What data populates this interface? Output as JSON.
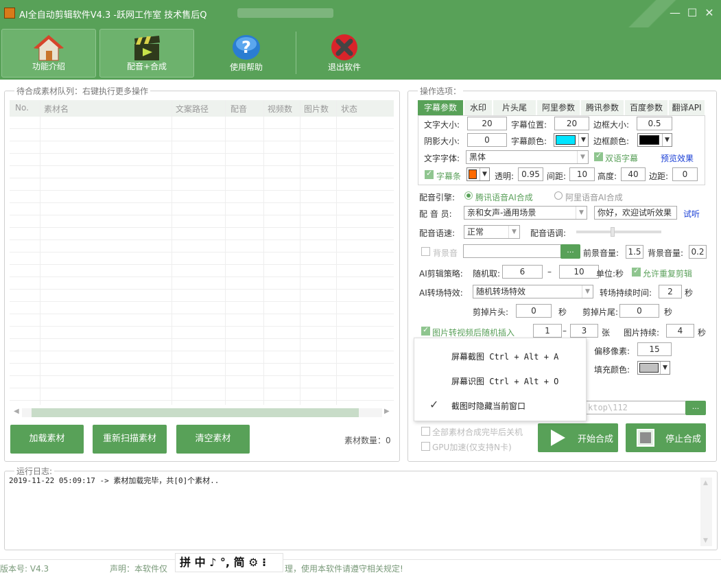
{
  "window": {
    "title": "AI全自动剪辑软件V4.3 -跃网工作室 技术售后Q",
    "controls": {
      "minimize": "—",
      "maximize": "☐",
      "close": "✕"
    }
  },
  "toolbar": {
    "intro": "功能介绍",
    "dub": "配音+合成",
    "help": "使用帮助",
    "exit": "退出软件"
  },
  "queue": {
    "title": "待合成素材队列：右键执行更多操作",
    "columns": [
      "No.",
      "素材名",
      "文案路径",
      "配音",
      "视频数",
      "图片数",
      "状态"
    ],
    "load_btn": "加载素材",
    "rescan_btn": "重新扫描素材",
    "clear_btn": "清空素材",
    "count_label": "素材数量：0"
  },
  "options": {
    "title": "操作选项：",
    "tabs": [
      "字幕参数",
      "水印",
      "片头尾",
      "阿里参数",
      "腾讯参数",
      "百度参数",
      "翻译API"
    ],
    "subtitle": {
      "font_size_label": "文字大小:",
      "font_size": "20",
      "position_label": "字幕位置:",
      "position": "20",
      "border_size_label": "边框大小:",
      "border_size": "0.5",
      "shadow_label": "阴影大小:",
      "shadow": "0",
      "color_label": "字幕颜色:",
      "color": "#00e5ff",
      "border_color_label": "边框颜色:",
      "border_color": "#000000",
      "font_label": "文字字体:",
      "font": "黑体",
      "bilingual": "双语字幕",
      "preview": "预览效果",
      "bar_label": "字幕条",
      "bar_color": "#ff6a00",
      "alpha_label": "透明:",
      "alpha": "0.95",
      "spacing_label": "间距:",
      "spacing": "10",
      "height_label": "高度:",
      "height": "40",
      "margin_label": "边距:",
      "margin": "0"
    },
    "voice": {
      "engine_label": "配音引擎:",
      "engine_tencent": "腾讯语音AI合成",
      "engine_ali": "阿里语音AI合成",
      "speaker_label": "配 音 员:",
      "speaker": "亲和女声-通用场景",
      "test_text": "你好，欢迎试听效果",
      "try": "试听",
      "speed_label": "配音语速:",
      "speed": "正常",
      "pitch_label": "配音语调:"
    },
    "bgm": {
      "label": "背景音",
      "browse": "...",
      "front_vol_label": "前景音量:",
      "front_vol": "1.5",
      "back_vol_label": "背景音量:",
      "back_vol": "0.2"
    },
    "ai_cut": {
      "label": "AI剪辑策略:",
      "random_label": "随机取:",
      "from": "6",
      "dash": "–",
      "to": "10",
      "unit": "单位:秒",
      "allow_repeat": "允许重复剪辑"
    },
    "transition": {
      "label": "AI转场特效:",
      "value": "随机转场特效",
      "duration_label": "转场持续时间:",
      "duration": "2",
      "sec": "秒"
    },
    "trim": {
      "head_label": "剪掉片头:",
      "head": "0",
      "head_sec": "秒",
      "tail_label": "剪掉片尾:",
      "tail": "0",
      "tail_sec": "秒"
    },
    "image": {
      "label": "图片转视频后随机插入",
      "from": "1",
      "dash": "–",
      "to": "3",
      "unit": "张",
      "duration_label": "图片持续:",
      "duration": "4",
      "sec": "秒"
    },
    "misc": {
      "offset_label": "偏移像素:",
      "offset": "15",
      "fill_label": "填充颜色:",
      "fill_color": "#c0c0c0",
      "path_fragment": "ktop\\112",
      "browse2": "..."
    },
    "shutdown": "全部素材合成完毕后关机",
    "gpu": "GPU加速(仅支持N卡)",
    "start_btn": "开始合成",
    "stop_btn": "停止合成"
  },
  "context_menu": {
    "items": [
      "屏幕截图 Ctrl + Alt + A",
      "屏幕识图 Ctrl + Alt + O",
      "截图时隐藏当前窗口"
    ],
    "checked_mark": "✓"
  },
  "log": {
    "title": "运行日志:",
    "line": "2019-11-22 05:09:17 -> 素材加载完毕，共[0]个素材.."
  },
  "statusbar": {
    "version": "版本号: V4.3",
    "notice_start": "声明：本软件仅",
    "notice_end": "理，使用本软件请遵守相关规定!"
  },
  "ime": {
    "text": "拼 中 ♪ °, 简 ⚙ ⁝"
  }
}
